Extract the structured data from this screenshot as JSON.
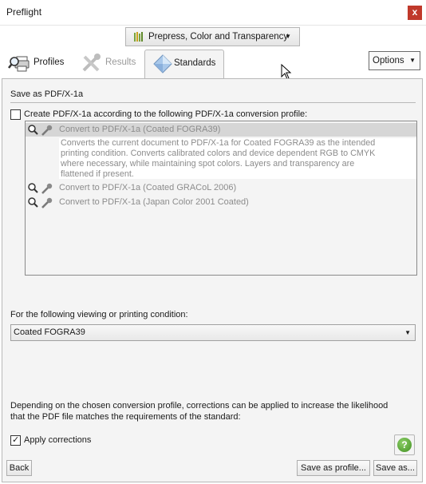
{
  "window": {
    "title": "Preflight",
    "close_label": "x"
  },
  "profile_selector": {
    "value": "Prepress, Color and Transparency",
    "icon": "bars-chart-icon"
  },
  "tabs": [
    {
      "label": "Profiles",
      "icon": "magnifier-printer-icon",
      "active": false,
      "enabled": true
    },
    {
      "label": "Results",
      "icon": "wrench-cross-icon",
      "active": false,
      "enabled": false
    },
    {
      "label": "Standards",
      "icon": "diamond-icon",
      "active": true,
      "enabled": true
    }
  ],
  "options_button": {
    "label": "Options"
  },
  "section": {
    "heading": "Save as PDF/X-1a"
  },
  "create_option": {
    "label": "Create PDF/X-1a according to the following PDF/X-1a conversion profile:",
    "checked": false
  },
  "conversion_profiles": [
    {
      "name": "Convert to PDF/X-1a (Coated FOGRA39)",
      "selected": true,
      "description_lines": [
        "Converts the current document to PDF/X-1a for Coated FOGRA39 as the intended",
        "printing condition. Converts calibrated colors and device dependent RGB to CMYK",
        "where necessary, while maintaining spot colors. Layers and transparency are",
        "flattened if present."
      ]
    },
    {
      "name": "Convert to PDF/X-1a (Coated GRACoL 2006)",
      "selected": false
    },
    {
      "name": "Convert to PDF/X-1a (Japan Color 2001 Coated)",
      "selected": false
    }
  ],
  "condition": {
    "label": "For the following viewing or printing condition:",
    "value": "Coated FOGRA39"
  },
  "note": {
    "line1": "Depending on the chosen conversion profile, corrections can be applied to increase the likelihood",
    "line2": "that the PDF file matches the requirements of the standard:"
  },
  "apply_corrections": {
    "label": "Apply corrections",
    "checked": true
  },
  "buttons": {
    "back": "Back",
    "save_as_profile": "Save as profile...",
    "save_as": "Save as...",
    "help": "?"
  },
  "colors": {
    "close": "#c0392b",
    "panel_bg": "#f4f4f4",
    "help_green": "#3f8f1f"
  }
}
